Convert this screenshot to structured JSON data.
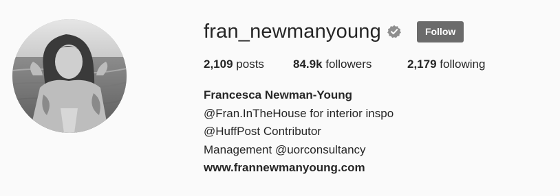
{
  "profile": {
    "username": "fran_newmanyoung",
    "verified_icon": "verified-badge-icon",
    "follow_label": "Follow",
    "colors": {
      "background": "#fafafa",
      "text": "#262626",
      "follow_button": "#6b6b6b",
      "verified_badge": "#8e8e8e"
    }
  },
  "stats": {
    "posts": {
      "count": "2,109",
      "label": "posts"
    },
    "followers": {
      "count": "84.9k",
      "label": "followers"
    },
    "following": {
      "count": "2,179",
      "label": "following"
    }
  },
  "bio": {
    "full_name": "Francesca Newman-Young",
    "lines": [
      "@Fran.InTheHouse for interior inspo",
      "@HuffPost Contributor",
      "Management @uorconsultancy"
    ],
    "website": "www.frannewmanyoung.com"
  }
}
